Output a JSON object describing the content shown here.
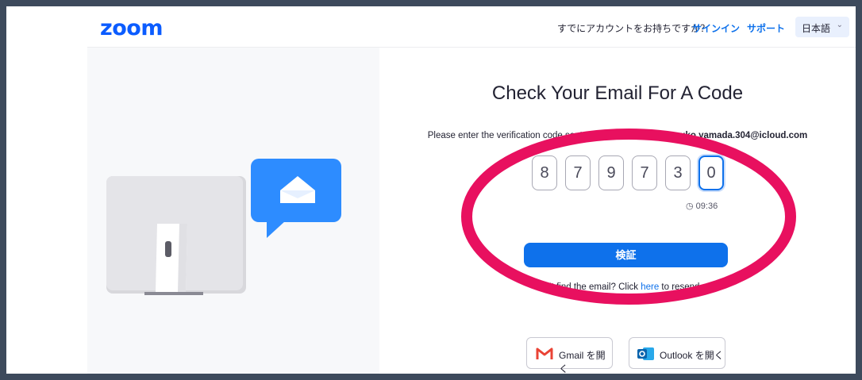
{
  "header": {
    "logo": "zoom",
    "question": "すでにアカウントをお持ちですか？",
    "signin": "サインイン",
    "support": "サポート",
    "language": "日本語"
  },
  "main": {
    "title": "Check Your Email For A Code",
    "instruction_prefix": "Please enter the verification code sent to your email address ",
    "email": "yuko.yamada.304@icloud.com",
    "code_digits": [
      "8",
      "7",
      "9",
      "7",
      "3",
      "0"
    ],
    "timer": "09:36",
    "verify_label": "検証",
    "resend_prefix": "Can't find the email? Click ",
    "resend_link": "here",
    "resend_suffix": " to resend."
  },
  "mail_buttons": {
    "gmail": "Gmail を開く",
    "outlook": "Outlook を開く"
  },
  "colors": {
    "brand": "#0b5cff",
    "accent": "#0e71eb",
    "annotation": "#e8105f"
  },
  "icons": [
    "clock-icon",
    "chevron-down-icon",
    "gmail-icon",
    "outlook-icon",
    "envelope-icon"
  ]
}
